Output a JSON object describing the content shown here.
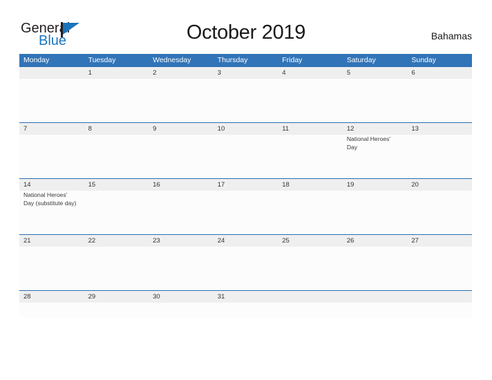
{
  "brand": {
    "name_part1": "General",
    "name_part2": "Blue",
    "mark": "flag-triangle"
  },
  "header": {
    "title": "October 2019",
    "country": "Bahamas"
  },
  "colors": {
    "header_blue": "#3174b8",
    "rule_blue": "#2a6eb0",
    "date_strip_gray": "#efefef",
    "brand_blue": "#1b75bc",
    "page_background": "#ffffff"
  },
  "weekdays": [
    "Monday",
    "Tuesday",
    "Wednesday",
    "Thursday",
    "Friday",
    "Saturday",
    "Sunday"
  ],
  "weeks": [
    {
      "days": [
        {
          "date": "",
          "event": ""
        },
        {
          "date": "1",
          "event": ""
        },
        {
          "date": "2",
          "event": ""
        },
        {
          "date": "3",
          "event": ""
        },
        {
          "date": "4",
          "event": ""
        },
        {
          "date": "5",
          "event": ""
        },
        {
          "date": "6",
          "event": ""
        }
      ]
    },
    {
      "days": [
        {
          "date": "7",
          "event": ""
        },
        {
          "date": "8",
          "event": ""
        },
        {
          "date": "9",
          "event": ""
        },
        {
          "date": "10",
          "event": ""
        },
        {
          "date": "11",
          "event": ""
        },
        {
          "date": "12",
          "event": "National Heroes' Day"
        },
        {
          "date": "13",
          "event": ""
        }
      ]
    },
    {
      "days": [
        {
          "date": "14",
          "event": "National Heroes' Day (substitute day)"
        },
        {
          "date": "15",
          "event": ""
        },
        {
          "date": "16",
          "event": ""
        },
        {
          "date": "17",
          "event": ""
        },
        {
          "date": "18",
          "event": ""
        },
        {
          "date": "19",
          "event": ""
        },
        {
          "date": "20",
          "event": ""
        }
      ]
    },
    {
      "days": [
        {
          "date": "21",
          "event": ""
        },
        {
          "date": "22",
          "event": ""
        },
        {
          "date": "23",
          "event": ""
        },
        {
          "date": "24",
          "event": ""
        },
        {
          "date": "25",
          "event": ""
        },
        {
          "date": "26",
          "event": ""
        },
        {
          "date": "27",
          "event": ""
        }
      ]
    },
    {
      "days": [
        {
          "date": "28",
          "event": ""
        },
        {
          "date": "29",
          "event": ""
        },
        {
          "date": "30",
          "event": ""
        },
        {
          "date": "31",
          "event": ""
        },
        {
          "date": "",
          "event": ""
        },
        {
          "date": "",
          "event": ""
        },
        {
          "date": "",
          "event": ""
        }
      ]
    }
  ]
}
